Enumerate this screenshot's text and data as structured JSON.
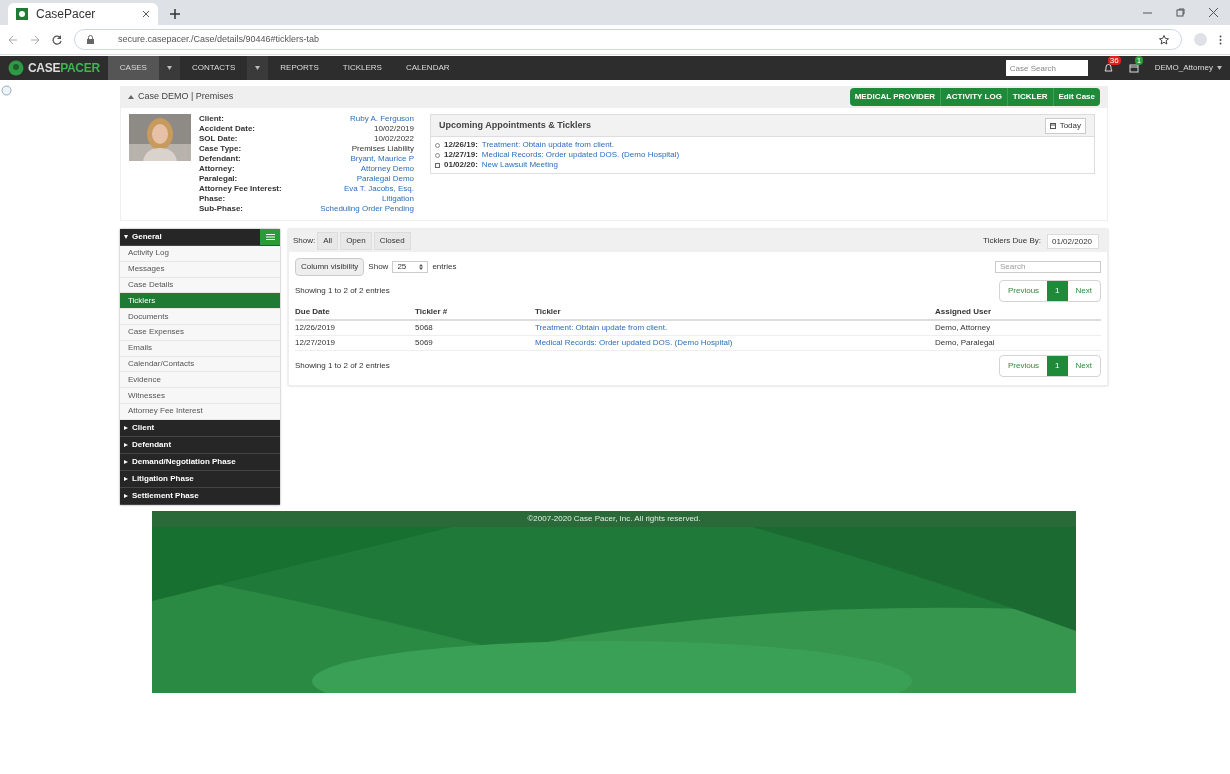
{
  "browser": {
    "tab_title": "CasePacer",
    "url": "secure.casepacer./Case/details/90446#ticklers-tab"
  },
  "nav": {
    "logo_first": "CASE",
    "logo_second": "PACER",
    "items": [
      {
        "label": "CASES",
        "selected": true,
        "dropdown": true
      },
      {
        "label": "CONTACTS",
        "selected": false,
        "dropdown": true
      },
      {
        "label": "REPORTS",
        "selected": false,
        "dropdown": false
      },
      {
        "label": "TICKLERS",
        "selected": false,
        "dropdown": false
      },
      {
        "label": "CALENDAR",
        "selected": false,
        "dropdown": false
      }
    ],
    "search_placeholder": "Case Search",
    "alerts_count": "36",
    "calendar_count": "1",
    "user": "DEMO_Attorney"
  },
  "case": {
    "title": "Case DEMO | Premises",
    "actions": [
      "MEDICAL PROVIDER",
      "ACTIVITY LOG",
      "TICKLER",
      "Edit Case"
    ],
    "details": [
      {
        "label": "Client:",
        "value": "Ruby A. Ferguson",
        "link": true
      },
      {
        "label": "Accident Date:",
        "value": "10/02/2019",
        "link": false
      },
      {
        "label": "SOL Date:",
        "value": "10/02/2022",
        "link": false
      },
      {
        "label": "Case Type:",
        "value": "Premises Liability",
        "link": false
      },
      {
        "label": "Defendant:",
        "value": "Bryant, Maurice P",
        "link": true
      },
      {
        "label": "Attorney:",
        "value": "Attorney Demo",
        "link": true
      },
      {
        "label": "Paralegal:",
        "value": "Paralegal Demo",
        "link": true
      },
      {
        "label": "Attorney Fee Interest:",
        "value": "Eva T. Jacobs, Esq.",
        "link": true
      },
      {
        "label": "Phase:",
        "value": "Litigation",
        "link": true
      },
      {
        "label": "Sub-Phase:",
        "value": "Scheduling Order Pending",
        "link": true
      }
    ],
    "appointments": {
      "title": "Upcoming Appointments & Ticklers",
      "today": "Today",
      "items": [
        {
          "kind": "tickler",
          "date": "12/26/19:",
          "text": "Treatment: Obtain update from client."
        },
        {
          "kind": "tickler",
          "date": "12/27/19:",
          "text": "Medical Records: Order updated DOS. (Demo Hospital)"
        },
        {
          "kind": "appointment",
          "date": "01/02/20:",
          "text": "New Lawsuit Meeting"
        }
      ]
    }
  },
  "sidebar": [
    {
      "label": "General",
      "expanded": true,
      "items": [
        {
          "label": "Activity Log",
          "selected": false
        },
        {
          "label": "Messages",
          "selected": false
        },
        {
          "label": "Case Details",
          "selected": false
        },
        {
          "label": "Ticklers",
          "selected": true
        },
        {
          "label": "Documents",
          "selected": false
        },
        {
          "label": "Case Expenses",
          "selected": false
        },
        {
          "label": "Emails",
          "selected": false
        },
        {
          "label": "Calendar/Contacts",
          "selected": false
        },
        {
          "label": "Evidence",
          "selected": false
        },
        {
          "label": "Witnesses",
          "selected": false
        },
        {
          "label": "Attorney Fee Interest",
          "selected": false
        }
      ]
    },
    {
      "label": "Client",
      "expanded": false
    },
    {
      "label": "Defendant",
      "expanded": false
    },
    {
      "label": "Demand/Negotiation Phase",
      "expanded": false
    },
    {
      "label": "Litigation Phase",
      "expanded": false
    },
    {
      "label": "Settlement Phase",
      "expanded": false
    }
  ],
  "ticklers": {
    "show_label": "Show:",
    "filters": [
      "All",
      "Open",
      "Closed"
    ],
    "due_by_label": "Ticklers Due By:",
    "due_by": "01/02/2020",
    "column_visibility": "Column visibility",
    "show": "Show",
    "page_size": "25",
    "entries": "entries",
    "search_placeholder": "Search",
    "info_top": "Showing 1 to 2 of 2 entries",
    "info_bottom": "Showing 1 to 2 of 2 entries",
    "pagination_top": {
      "previous": "Previous",
      "page": "1",
      "next": "Next"
    },
    "pagination_bottom": {
      "previous": "Previous",
      "page": "1",
      "next": "Next"
    },
    "columns": [
      "Due Date",
      "Tickler #",
      "Tickler",
      "Assigned User"
    ],
    "rows": [
      [
        "12/26/2019",
        "5068",
        "Treatment: Obtain update from client.",
        "Demo, Attorney"
      ],
      [
        "12/27/2019",
        "5069",
        "Medical Records: Order updated DOS. (Demo Hospital)",
        "Demo, Paralegal"
      ]
    ]
  },
  "footer": {
    "copyright": "©2007-2020 Case Pacer, Inc. All rights reserved."
  }
}
